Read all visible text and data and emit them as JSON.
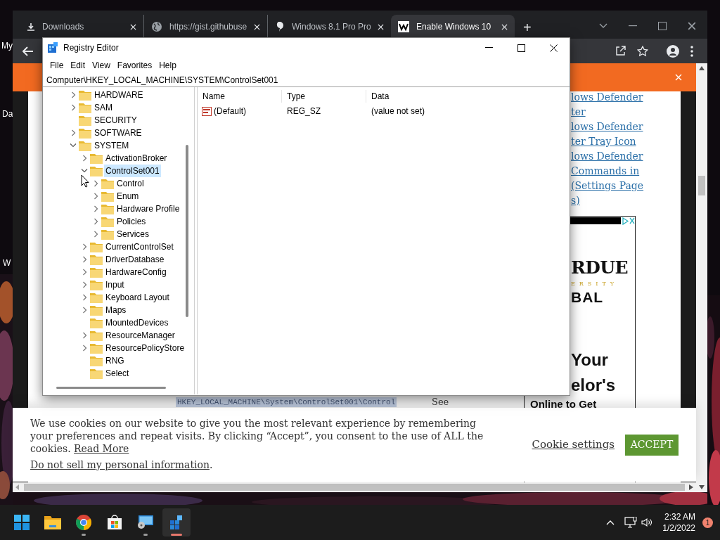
{
  "desktop": {
    "icon_labels": [
      "My",
      "Da",
      "W"
    ]
  },
  "browser": {
    "tabs": [
      {
        "title": "Downloads",
        "kind": "download",
        "selected": false
      },
      {
        "title": "https://gist.githubuse",
        "kind": "globe",
        "selected": false
      },
      {
        "title": "Windows 8.1 Pro Pro",
        "kind": "pin",
        "selected": false
      },
      {
        "title": "Enable Windows 10",
        "kind": "site",
        "selected": true
      }
    ],
    "new_tab": "+"
  },
  "page": {
    "links": [
      "lows Defender",
      "ter",
      "lows Defender",
      "ter Tray Icon",
      "lows Defender",
      "Commands in",
      "(Settings Page",
      "s)"
    ],
    "ad": {
      "lines": [
        {
          "text": "RDUE",
          "kind": "logo"
        },
        {
          "text": "ERSITY",
          "kind": "sub"
        },
        {
          "text": "BAL",
          "kind": "mark"
        },
        {
          "text": "Your",
          "kind": "head"
        },
        {
          "text": "elor's",
          "kind": "head"
        },
        {
          "text": "Online to Get",
          "kind": "head"
        }
      ]
    },
    "path_text": "HKEY_LOCAL_MACHINE\\System\\ControlSet001\\Control",
    "after_path": "See"
  },
  "cookie_banner": {
    "message": "We use cookies on our website to give you the most relevant experience by remembering your preferences and repeat visits. By clicking “Accept”, you consent to the use of ALL the cookies.",
    "read_more": "Read More",
    "do_not_sell": "Do not sell my personal information",
    "period": ".",
    "settings": "Cookie settings",
    "accept": "ACCEPT"
  },
  "registry_editor": {
    "title": "Registry Editor",
    "menu": [
      "File",
      "Edit",
      "View",
      "Favorites",
      "Help"
    ],
    "address": "Computer\\HKEY_LOCAL_MACHINE\\SYSTEM\\ControlSet001",
    "tree": [
      {
        "label": "HARDWARE",
        "expanded": false,
        "selected": false
      },
      {
        "label": "SAM",
        "expanded": false,
        "selected": false
      },
      {
        "label": "SECURITY",
        "selected": false
      },
      {
        "label": "SOFTWARE",
        "expanded": false,
        "selected": false
      },
      {
        "label": "SYSTEM",
        "expanded": true,
        "selected": false,
        "children": [
          {
            "label": "ActivationBroker",
            "expanded": false,
            "selected": false
          },
          {
            "label": "ControlSet001",
            "expanded": true,
            "selected": true,
            "children": [
              {
                "label": "Control",
                "expanded": false,
                "selected": false
              },
              {
                "label": "Enum",
                "expanded": false,
                "selected": false
              },
              {
                "label": "Hardware Profile",
                "expanded": false,
                "selected": false
              },
              {
                "label": "Policies",
                "expanded": false,
                "selected": false
              },
              {
                "label": "Services",
                "expanded": false,
                "selected": false
              }
            ]
          },
          {
            "label": "CurrentControlSet",
            "expanded": false,
            "selected": false
          },
          {
            "label": "DriverDatabase",
            "expanded": false,
            "selected": false
          },
          {
            "label": "HardwareConfig",
            "expanded": false,
            "selected": false
          },
          {
            "label": "Input",
            "expanded": false,
            "selected": false
          },
          {
            "label": "Keyboard Layout",
            "expanded": false,
            "selected": false
          },
          {
            "label": "Maps",
            "expanded": false,
            "selected": false
          },
          {
            "label": "MountedDevices",
            "selected": false
          },
          {
            "label": "ResourceManager",
            "expanded": false,
            "selected": false
          },
          {
            "label": "ResourcePolicyStore",
            "expanded": false,
            "selected": false
          },
          {
            "label": "RNG",
            "selected": false
          },
          {
            "label": "Select",
            "selected": false
          }
        ]
      }
    ],
    "columns": [
      "Name",
      "Type",
      "Data"
    ],
    "values": [
      {
        "name": "(Default)",
        "type": "REG_SZ",
        "data": "(value not set)"
      }
    ]
  },
  "taskbar": {
    "apps": [
      {
        "kind": "start",
        "running": false,
        "selected": false
      },
      {
        "kind": "explorer",
        "running": false,
        "selected": false
      },
      {
        "kind": "chrome",
        "running": true,
        "selected": false
      },
      {
        "kind": "store",
        "running": false,
        "selected": false
      },
      {
        "kind": "remote",
        "running": true,
        "selected": false
      },
      {
        "kind": "regedit",
        "running": true,
        "selected": true
      }
    ],
    "time": "2:32 AM",
    "date": "1/2/2022",
    "notifications": "1"
  }
}
